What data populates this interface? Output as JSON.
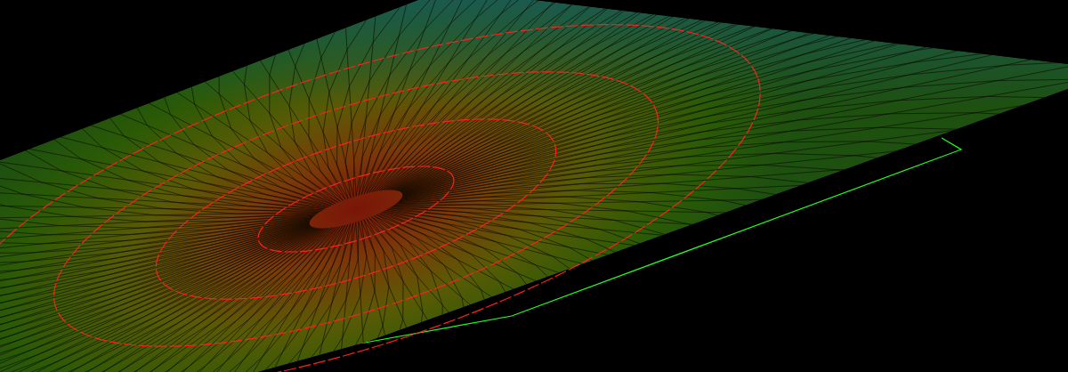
{
  "viewport": {
    "surface": {
      "kind": "tin"
    },
    "contours": {
      "shown": true
    },
    "boundary": {
      "shown": true
    }
  }
}
